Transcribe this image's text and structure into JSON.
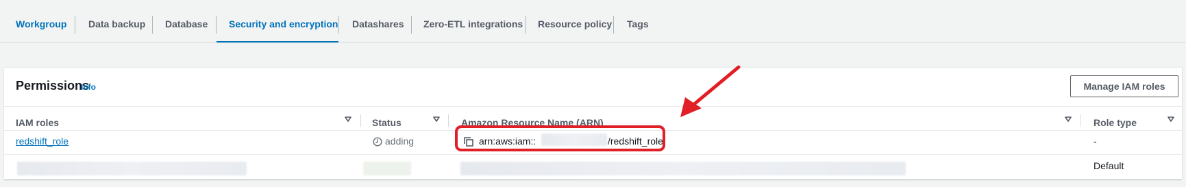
{
  "tabs": [
    {
      "label": "Workgroup"
    },
    {
      "label": "Data backup"
    },
    {
      "label": "Database"
    },
    {
      "label": "Security and encryption"
    },
    {
      "label": "Datashares"
    },
    {
      "label": "Zero-ETL integrations"
    },
    {
      "label": "Resource policy"
    },
    {
      "label": "Tags"
    }
  ],
  "active_tab": "Security and encryption",
  "permissions": {
    "title": "Permissions",
    "info_label": "Info",
    "manage_button": "Manage IAM roles",
    "columns": [
      "IAM roles",
      "Status",
      "Amazon Resource Name (ARN)",
      "Role type"
    ],
    "rows": [
      {
        "iam_role": "redshift_role",
        "status": "adding",
        "arn_prefix": "arn:aws:iam::",
        "arn_suffix": "/redshift_role",
        "role_type": "-"
      },
      {
        "iam_role": "",
        "status": "",
        "arn_prefix": "",
        "arn_suffix": "",
        "role_type": "Default"
      }
    ]
  },
  "colors": {
    "accent": "#0073bb",
    "highlight": "#e01f26",
    "text": "#16191f",
    "muted": "#545b64"
  },
  "icons": [
    "sort-caret-icon",
    "clock-icon",
    "copy-icon",
    "annotation-arrow-icon"
  ]
}
